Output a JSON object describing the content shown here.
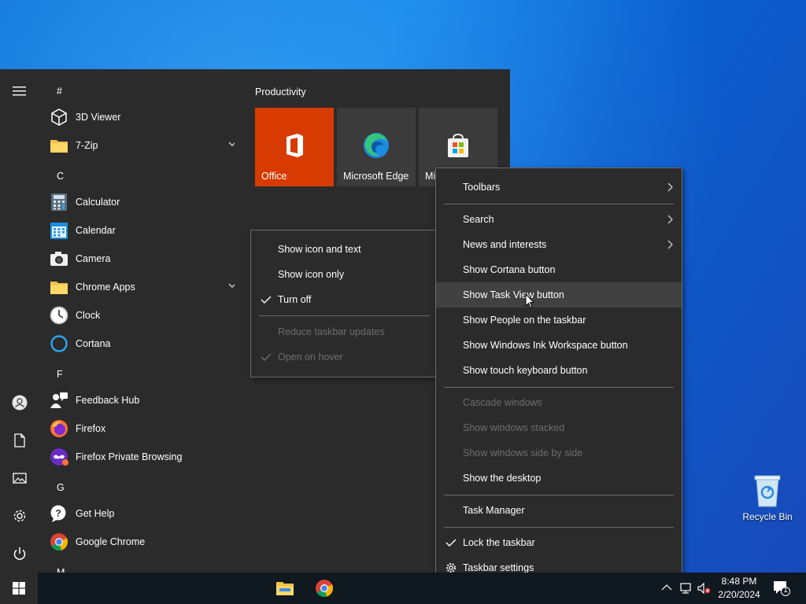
{
  "desktop": {
    "recycle_bin_label": "Recycle Bin"
  },
  "start_menu": {
    "rail_icons": [
      "hamburger-icon",
      "user-icon",
      "document-icon",
      "pictures-icon",
      "settings-icon",
      "power-icon"
    ],
    "sections": {
      "hash": "#",
      "c": "C",
      "f": "F",
      "g": "G",
      "m": "M"
    },
    "apps": {
      "viewer3d": "3D Viewer",
      "zip": "7-Zip",
      "calculator": "Calculator",
      "calendar": "Calendar",
      "camera": "Camera",
      "chrome_apps": "Chrome Apps",
      "clock": "Clock",
      "cortana": "Cortana",
      "feedback": "Feedback Hub",
      "firefox": "Firefox",
      "firefox_private": "Firefox Private Browsing",
      "get_help": "Get Help",
      "chrome": "Google Chrome"
    },
    "tiles_group": "Productivity",
    "tiles": {
      "office": "Office",
      "edge": "Microsoft Edge",
      "store": "Mi"
    },
    "colors": {
      "office_tile": "#d83b01",
      "tile": "#3b3b3b"
    }
  },
  "news_submenu": {
    "items": {
      "icon_text": "Show icon and text",
      "icon_only": "Show icon only",
      "turn_off": "Turn off",
      "reduce": "Reduce taskbar updates",
      "hover": "Open on hover"
    }
  },
  "taskbar_menu": {
    "items": {
      "toolbars": "Toolbars",
      "search": "Search",
      "news": "News and interests",
      "cortana": "Show Cortana button",
      "task_view": "Show Task View button",
      "people": "Show People on the taskbar",
      "ink": "Show Windows Ink Workspace button",
      "touch": "Show touch keyboard button",
      "cascade": "Cascade windows",
      "stacked": "Show windows stacked",
      "side": "Show windows side by side",
      "desktop": "Show the desktop",
      "task_manager": "Task Manager",
      "lock": "Lock the taskbar",
      "settings": "Taskbar settings"
    }
  },
  "taskbar": {
    "time": "8:48 PM",
    "date": "2/20/2024",
    "notification_count": "1"
  }
}
